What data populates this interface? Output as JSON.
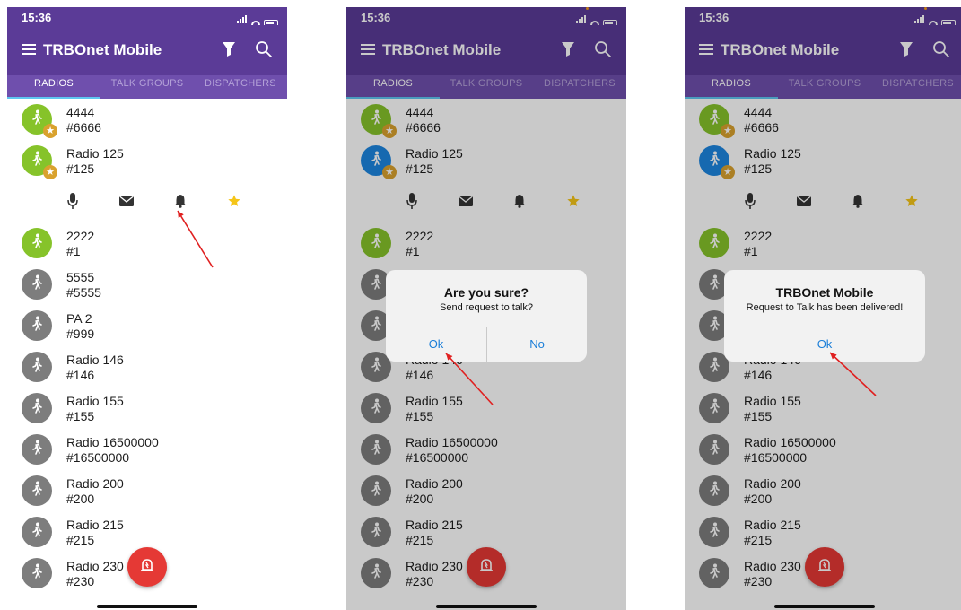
{
  "status": {
    "time": "15:36"
  },
  "app": {
    "title": "TRBOnet Mobile"
  },
  "tabs": [
    "RADIOS",
    "TALK GROUPS",
    "DISPATCHERS"
  ],
  "radios": [
    {
      "name": "4444",
      "num": "#6666"
    },
    {
      "name": "Radio 125",
      "num": "#125"
    },
    {
      "name": "2222",
      "num": "#1"
    },
    {
      "name": "5555",
      "num": "#5555"
    },
    {
      "name": "PA 2",
      "num": "#999"
    },
    {
      "name": "Radio 146",
      "num": "#146"
    },
    {
      "name": "Radio 155",
      "num": "#155"
    },
    {
      "name": "Radio 16500000",
      "num": "#16500000"
    },
    {
      "name": "Radio 200",
      "num": "#200"
    },
    {
      "name": "Radio 215",
      "num": "#215"
    },
    {
      "name": "Radio 230",
      "num": "#230"
    }
  ],
  "icons": {
    "menu": "hamburger-icon",
    "filter": "filter-icon",
    "search": "search-icon",
    "actions": [
      "microphone-icon",
      "envelope-icon",
      "bell-icon",
      "star-icon"
    ],
    "fab": "alarm-icon"
  },
  "dialogs": {
    "confirm": {
      "title": "Are you sure?",
      "message": "Send request to talk?",
      "ok": "Ok",
      "no": "No"
    },
    "info": {
      "title": "TRBOnet Mobile",
      "message": "Request to Talk has been delivered!",
      "ok": "Ok"
    }
  },
  "colors": {
    "appbar": "#5b3b97",
    "tabs": "#6f4fad",
    "tab_indicator": "#5fc6f0",
    "avatar_online": "#86c32a",
    "avatar_selected": "#1d86e0",
    "avatar_offline": "#7d7d7d",
    "favorite": "#d9a22e",
    "fab": "#e53935",
    "dialog_button": "#1a7ed8",
    "annotation_arrow": "#e02020"
  }
}
